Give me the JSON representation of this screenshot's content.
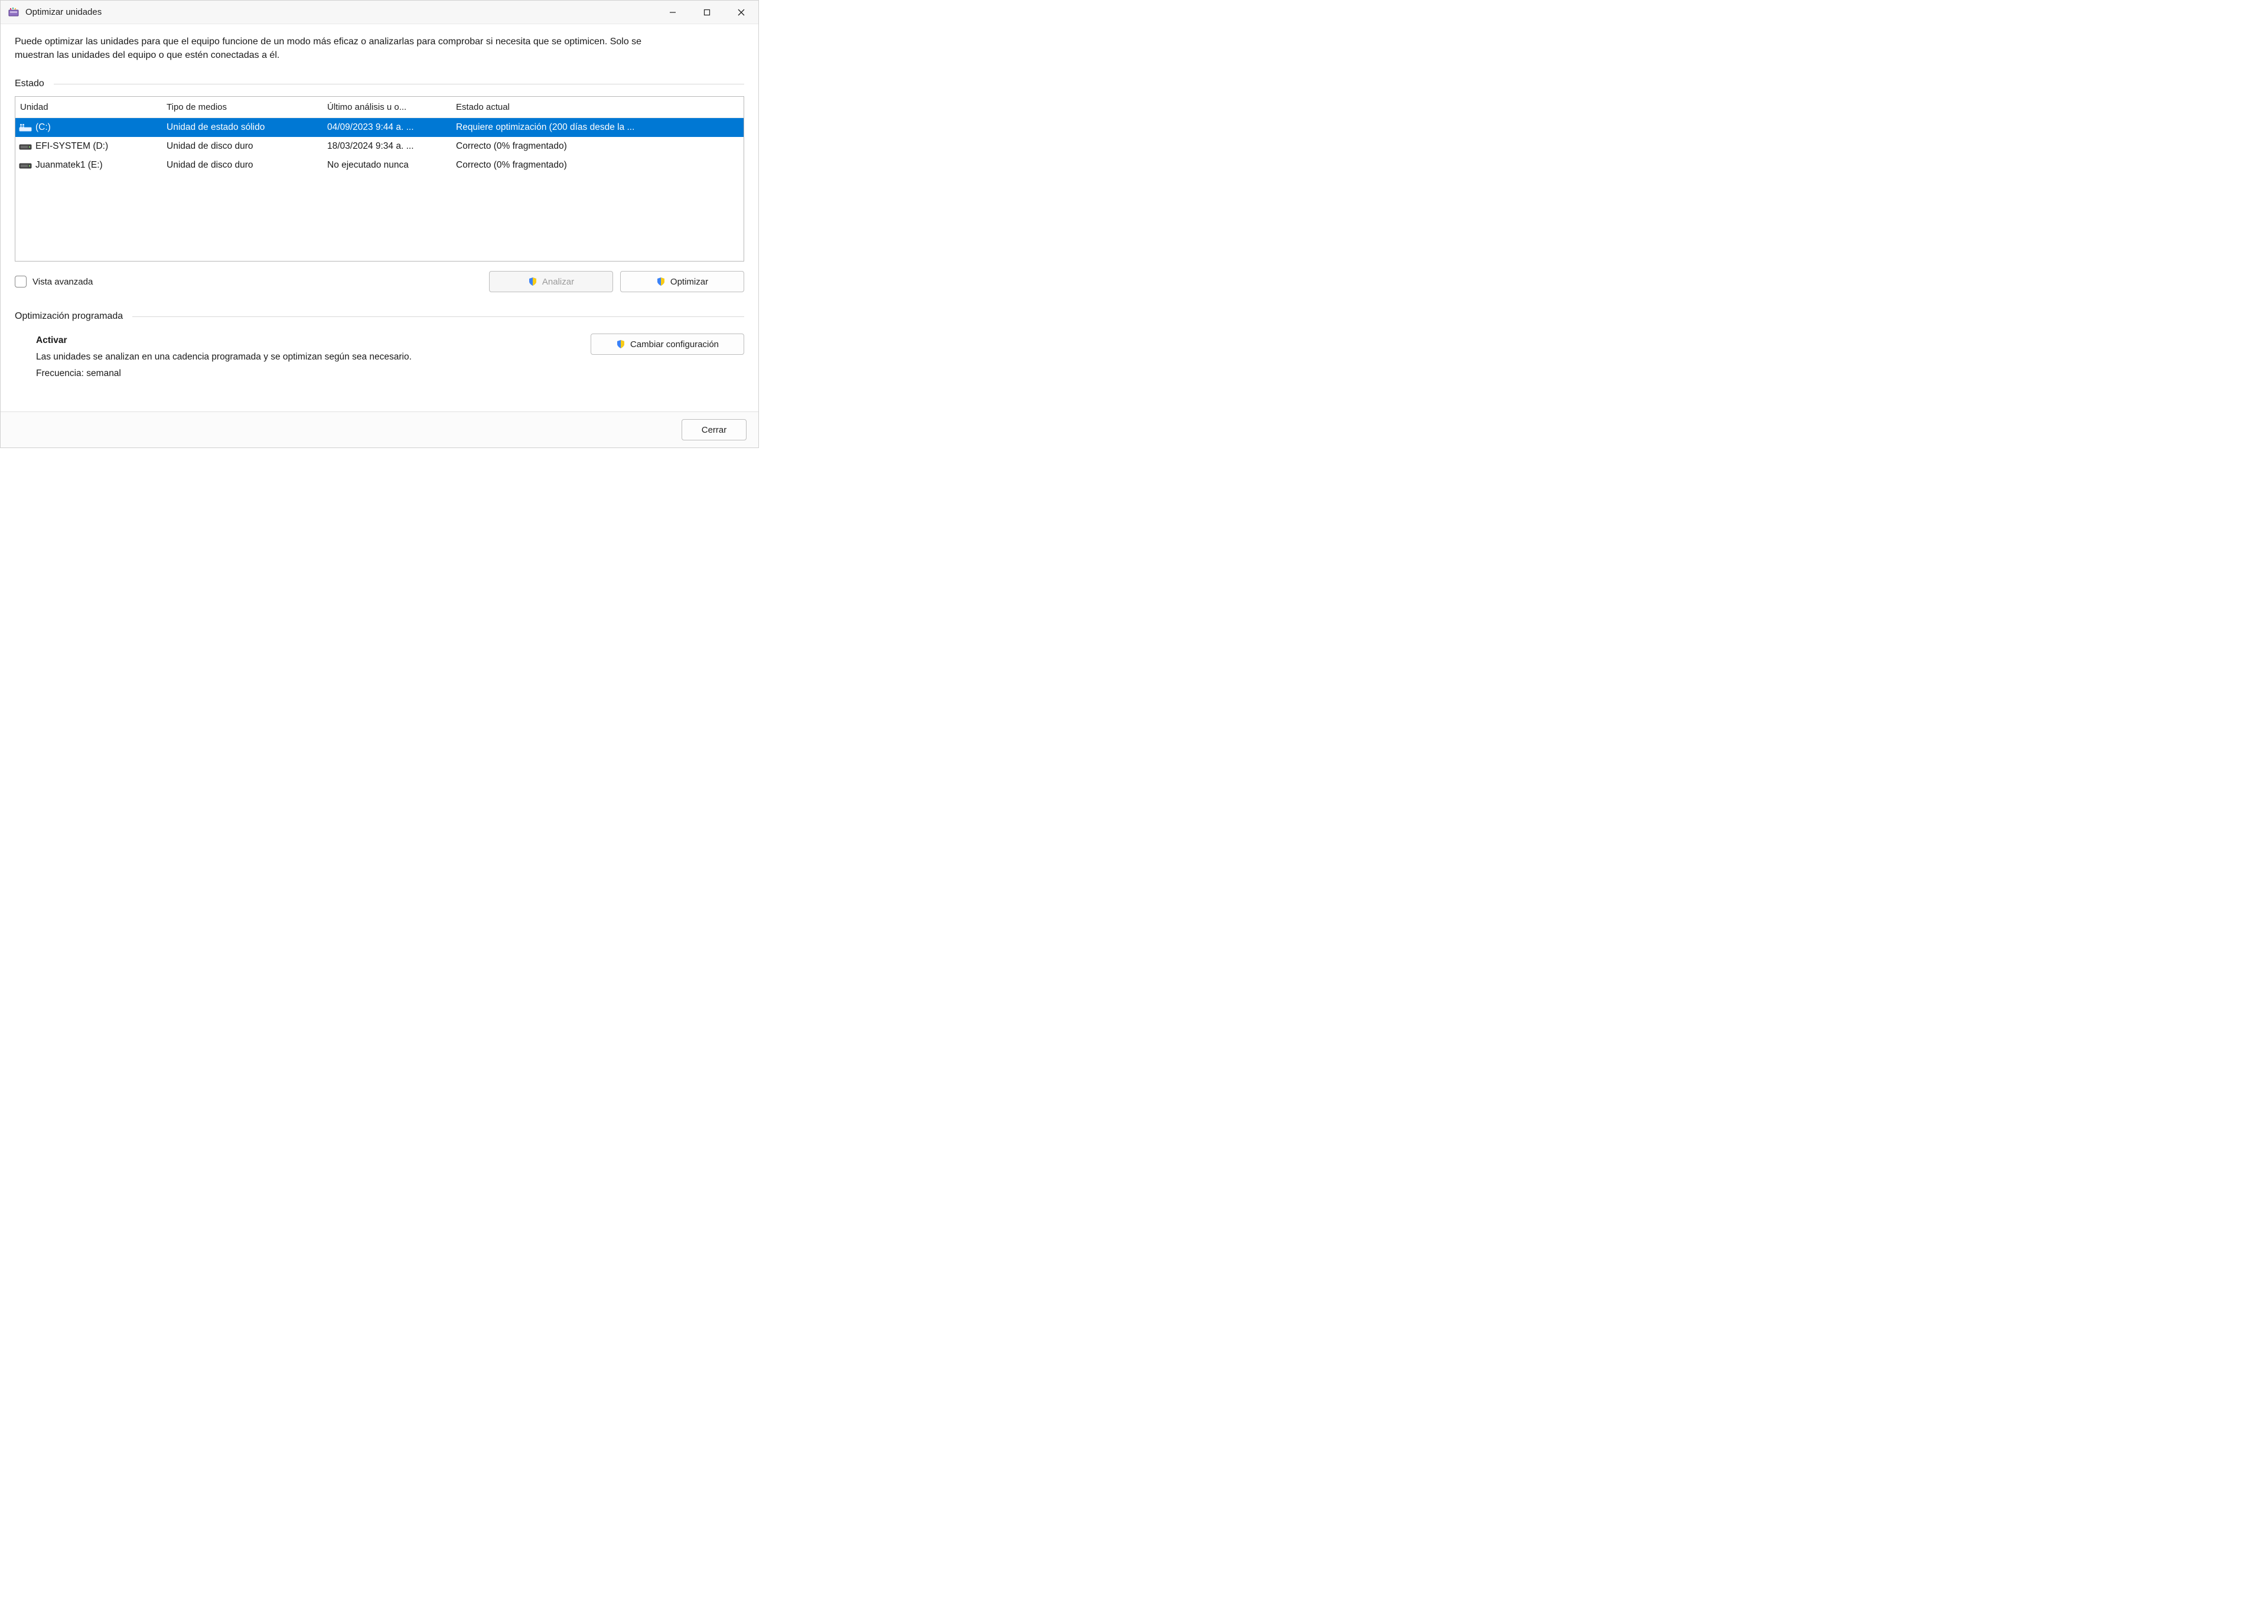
{
  "window": {
    "title": "Optimizar unidades"
  },
  "description": "Puede optimizar las unidades para que el equipo funcione de un modo más eficaz o analizarlas para comprobar si necesita que se optimicen. Solo se muestran las unidades del equipo o que estén conectadas a él.",
  "status_section_label": "Estado",
  "columns": {
    "unit": "Unidad",
    "media": "Tipo de medios",
    "last": "Último análisis u o...",
    "state": "Estado actual"
  },
  "drives": [
    {
      "icon": "ssd",
      "name": "(C:)",
      "media": "Unidad de estado sólido",
      "last": "04/09/2023 9:44 a. ...",
      "state": "Requiere optimización (200 días desde la ...",
      "selected": true
    },
    {
      "icon": "hdd",
      "name": "EFI-SYSTEM (D:)",
      "media": "Unidad de disco duro",
      "last": "18/03/2024 9:34 a. ...",
      "state": "Correcto (0% fragmentado)",
      "selected": false
    },
    {
      "icon": "hdd",
      "name": "Juanmatek1 (E:)",
      "media": "Unidad de disco duro",
      "last": "No ejecutado nunca",
      "state": "Correcto (0% fragmentado)",
      "selected": false
    }
  ],
  "advanced_view_label": "Vista avanzada",
  "buttons": {
    "analyze": "Analizar",
    "optimize": "Optimizar",
    "change_settings": "Cambiar configuración",
    "close": "Cerrar"
  },
  "scheduled": {
    "section_label": "Optimización programada",
    "heading": "Activar",
    "body": "Las unidades se analizan en una cadencia programada y se optimizan según sea necesario.",
    "frequency_line": "Frecuencia: semanal"
  }
}
